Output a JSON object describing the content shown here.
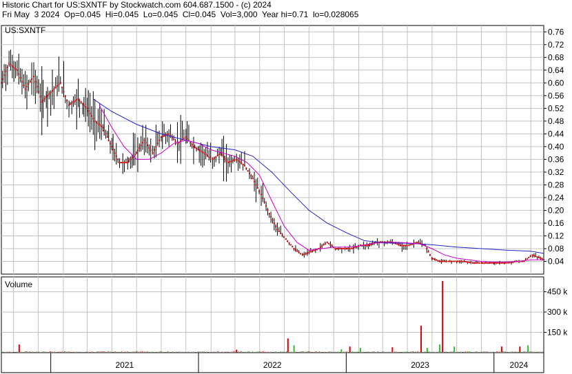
{
  "header": {
    "line1": "Historic Chart for US:SXNTF by Stockwatch.com 604.687.1500 - (c) 2024",
    "line2": "Fri May  3 2024  Op=0.045  Hi=0.045  Lo=0.045  Cl=0.045  Vol=3,000  Year hi=0.71  lo=0.028065"
  },
  "colors": {
    "price_bar": "#000000",
    "close_dot": "#cc0000",
    "ma_short": "#cc00cc",
    "ma_long": "#2222cc",
    "vol_up": "#33bb33",
    "vol_down": "#dd0000",
    "vol_flat": "#999999",
    "grid": "#c0c0c0"
  },
  "chart_data": [
    {
      "type": "line",
      "title": "US:SXNTF",
      "ylim": [
        0.0,
        0.78
      ],
      "y_ticks": [
        "0.76",
        "0.72",
        "0.68",
        "0.64",
        "0.60",
        "0.56",
        "0.52",
        "0.48",
        "0.44",
        "0.40",
        "0.36",
        "0.32",
        "0.28",
        "0.24",
        "0.20",
        "0.16",
        "0.12",
        "0.08",
        "0.04"
      ],
      "x_ticks": [
        "2021",
        "2022",
        "2023",
        "2024"
      ],
      "x_ticks_dates": [
        "2021-01-01",
        "2022-01-01",
        "2023-01-01",
        "2024-01-01"
      ],
      "x_range": [
        "2020-09-01",
        "2024-05-03"
      ],
      "grid": true,
      "series": [
        {
          "role": "price",
          "points": [
            [
              "2020-09-01",
              0.6
            ],
            [
              "2020-09-20",
              0.66
            ],
            [
              "2020-10-10",
              0.64
            ],
            [
              "2020-10-30",
              0.58
            ],
            [
              "2020-11-20",
              0.62
            ],
            [
              "2020-12-10",
              0.54
            ],
            [
              "2021-01-01",
              0.57
            ],
            [
              "2021-01-25",
              0.6
            ],
            [
              "2021-02-15",
              0.53
            ],
            [
              "2021-03-10",
              0.55
            ],
            [
              "2021-04-01",
              0.52
            ],
            [
              "2021-04-20",
              0.48
            ],
            [
              "2021-05-10",
              0.46
            ],
            [
              "2021-06-01",
              0.4
            ],
            [
              "2021-06-20",
              0.35
            ],
            [
              "2021-07-10",
              0.35
            ],
            [
              "2021-08-01",
              0.38
            ],
            [
              "2021-08-20",
              0.42
            ],
            [
              "2021-09-10",
              0.38
            ],
            [
              "2021-10-01",
              0.43
            ],
            [
              "2021-10-20",
              0.44
            ],
            [
              "2021-11-10",
              0.41
            ],
            [
              "2021-12-01",
              0.43
            ],
            [
              "2021-12-20",
              0.4
            ],
            [
              "2022-01-15",
              0.38
            ],
            [
              "2022-02-05",
              0.36
            ],
            [
              "2022-02-25",
              0.38
            ],
            [
              "2022-03-15",
              0.35
            ],
            [
              "2022-04-05",
              0.36
            ],
            [
              "2022-04-25",
              0.34
            ],
            [
              "2022-05-15",
              0.3
            ],
            [
              "2022-06-05",
              0.25
            ],
            [
              "2022-06-25",
              0.19
            ],
            [
              "2022-07-15",
              0.14
            ],
            [
              "2022-08-05",
              0.11
            ],
            [
              "2022-08-25",
              0.08
            ],
            [
              "2022-09-15",
              0.06
            ],
            [
              "2022-10-05",
              0.07
            ],
            [
              "2022-10-25",
              0.08
            ],
            [
              "2022-11-15",
              0.1
            ],
            [
              "2022-12-05",
              0.08
            ],
            [
              "2022-12-25",
              0.08
            ],
            [
              "2023-01-15",
              0.08
            ],
            [
              "2023-02-05",
              0.09
            ],
            [
              "2023-02-25",
              0.09
            ],
            [
              "2023-03-15",
              0.1
            ],
            [
              "2023-04-05",
              0.1
            ],
            [
              "2023-04-25",
              0.1
            ],
            [
              "2023-05-15",
              0.09
            ],
            [
              "2023-06-05",
              0.09
            ],
            [
              "2023-06-25",
              0.1
            ],
            [
              "2023-07-15",
              0.09
            ],
            [
              "2023-08-01",
              0.05
            ],
            [
              "2023-08-20",
              0.04
            ],
            [
              "2023-09-10",
              0.04
            ],
            [
              "2023-10-01",
              0.04
            ],
            [
              "2023-10-20",
              0.04
            ],
            [
              "2023-11-10",
              0.035
            ],
            [
              "2023-12-01",
              0.035
            ],
            [
              "2023-12-20",
              0.035
            ],
            [
              "2024-01-15",
              0.035
            ],
            [
              "2024-02-05",
              0.035
            ],
            [
              "2024-02-25",
              0.04
            ],
            [
              "2024-03-15",
              0.04
            ],
            [
              "2024-04-05",
              0.06
            ],
            [
              "2024-04-25",
              0.05
            ],
            [
              "2024-05-03",
              0.045
            ]
          ]
        },
        {
          "role": "ma_short",
          "points": [
            [
              "2021-05-01",
              0.53
            ],
            [
              "2021-06-01",
              0.46
            ],
            [
              "2021-07-01",
              0.4
            ],
            [
              "2021-08-01",
              0.36
            ],
            [
              "2021-09-01",
              0.36
            ],
            [
              "2021-10-01",
              0.38
            ],
            [
              "2021-11-01",
              0.41
            ],
            [
              "2021-12-01",
              0.42
            ],
            [
              "2022-01-01",
              0.41
            ],
            [
              "2022-02-01",
              0.39
            ],
            [
              "2022-03-01",
              0.38
            ],
            [
              "2022-04-01",
              0.37
            ],
            [
              "2022-05-01",
              0.35
            ],
            [
              "2022-06-01",
              0.31
            ],
            [
              "2022-07-01",
              0.23
            ],
            [
              "2022-08-01",
              0.15
            ],
            [
              "2022-09-01",
              0.1
            ],
            [
              "2022-10-01",
              0.075
            ],
            [
              "2022-11-01",
              0.08
            ],
            [
              "2022-12-01",
              0.085
            ],
            [
              "2023-01-01",
              0.085
            ],
            [
              "2023-02-01",
              0.088
            ],
            [
              "2023-03-01",
              0.095
            ],
            [
              "2023-04-01",
              0.1
            ],
            [
              "2023-05-01",
              0.1
            ],
            [
              "2023-06-01",
              0.098
            ],
            [
              "2023-07-01",
              0.095
            ],
            [
              "2023-08-01",
              0.08
            ],
            [
              "2023-09-01",
              0.06
            ],
            [
              "2023-10-01",
              0.05
            ],
            [
              "2023-11-01",
              0.045
            ],
            [
              "2023-12-01",
              0.04
            ],
            [
              "2024-01-01",
              0.038
            ],
            [
              "2024-02-01",
              0.038
            ],
            [
              "2024-03-01",
              0.04
            ],
            [
              "2024-04-01",
              0.045
            ],
            [
              "2024-05-03",
              0.045
            ]
          ]
        },
        {
          "role": "ma_long",
          "points": [
            [
              "2021-04-15",
              0.55
            ],
            [
              "2021-06-01",
              0.51
            ],
            [
              "2021-08-01",
              0.47
            ],
            [
              "2021-10-01",
              0.44
            ],
            [
              "2021-12-01",
              0.42
            ],
            [
              "2022-02-01",
              0.4
            ],
            [
              "2022-04-01",
              0.39
            ],
            [
              "2022-05-15",
              0.37
            ],
            [
              "2022-07-01",
              0.32
            ],
            [
              "2022-08-15",
              0.26
            ],
            [
              "2022-10-01",
              0.2
            ],
            [
              "2022-11-15",
              0.16
            ],
            [
              "2023-01-01",
              0.13
            ],
            [
              "2023-02-15",
              0.105
            ],
            [
              "2023-04-01",
              0.098
            ],
            [
              "2023-06-01",
              0.097
            ],
            [
              "2023-08-01",
              0.092
            ],
            [
              "2023-10-01",
              0.085
            ],
            [
              "2023-12-01",
              0.08
            ],
            [
              "2024-02-01",
              0.075
            ],
            [
              "2024-04-01",
              0.072
            ],
            [
              "2024-05-03",
              0.065
            ]
          ]
        }
      ]
    },
    {
      "type": "bar",
      "title": "Volume",
      "ylim": [
        0,
        560000
      ],
      "y_ticks": [
        "450 k",
        "300 k",
        "150 k"
      ],
      "spikes": [
        [
          "2020-10-15",
          60000,
          "down"
        ],
        [
          "2022-04-05",
          22000,
          "down"
        ],
        [
          "2022-08-10",
          105000,
          "down"
        ],
        [
          "2022-08-25",
          55000,
          "up"
        ],
        [
          "2022-12-20",
          25000,
          "up"
        ],
        [
          "2023-01-10",
          45000,
          "down"
        ],
        [
          "2023-02-05",
          35000,
          "up"
        ],
        [
          "2023-04-25",
          40000,
          "down"
        ],
        [
          "2023-07-05",
          200000,
          "down"
        ],
        [
          "2023-07-20",
          35000,
          "up"
        ],
        [
          "2023-08-20",
          60000,
          "up"
        ],
        [
          "2023-08-27",
          530000,
          "down"
        ],
        [
          "2023-09-25",
          45000,
          "up"
        ],
        [
          "2024-01-20",
          45000,
          "down"
        ],
        [
          "2024-03-05",
          45000,
          "down"
        ],
        [
          "2024-03-25",
          55000,
          "up"
        ]
      ]
    }
  ]
}
